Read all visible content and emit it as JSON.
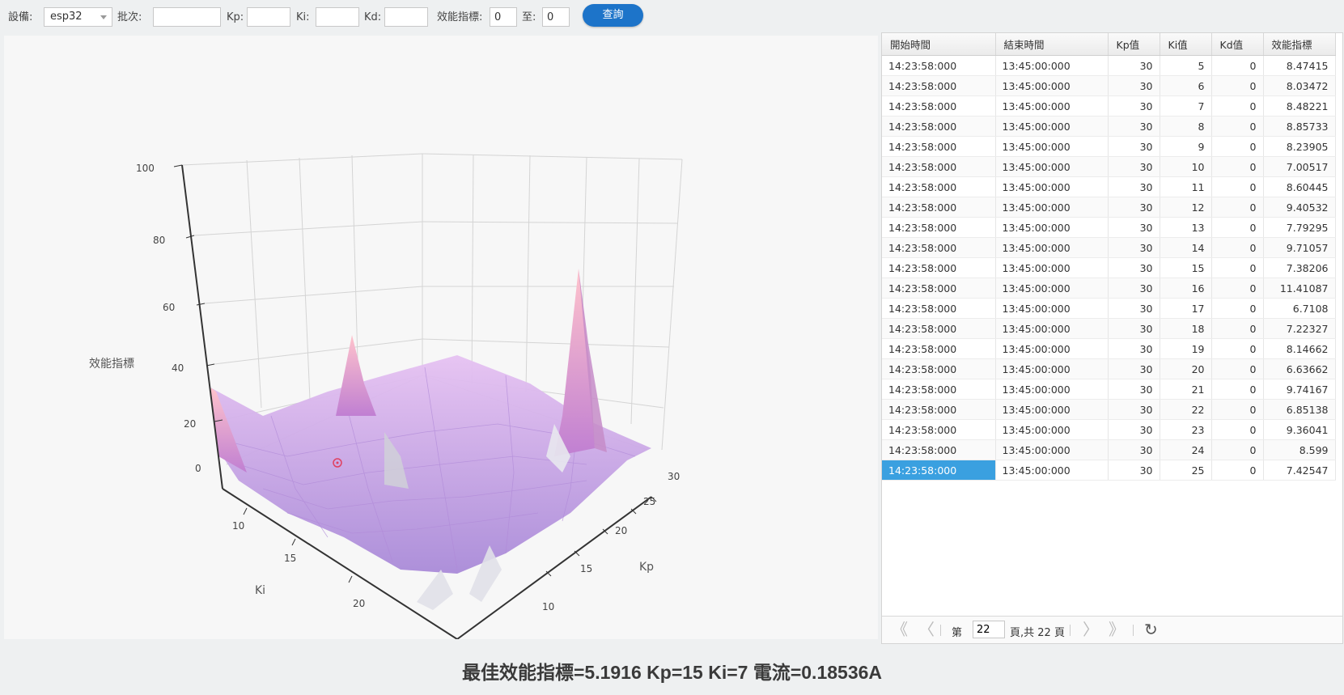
{
  "toolbar": {
    "device_label": "設備:",
    "device_value": "esp32",
    "batch_label": "批次:",
    "batch_value": "",
    "kp_label": "Kp:",
    "kp_value": "",
    "ki_label": "Ki:",
    "ki_value": "",
    "kd_label": "Kd:",
    "kd_value": "",
    "perf_label": "效能指標:",
    "perf_from": "0",
    "perf_to_label": "至:",
    "perf_to": "0",
    "query_button": "查詢"
  },
  "chart_data": {
    "type": "surface3d",
    "zlabel": "效能指標",
    "ylabel": "Ki",
    "xlabel": "Kp",
    "z_ticks": [
      "0",
      "20",
      "40",
      "60",
      "80",
      "100"
    ],
    "ki_ticks": [
      "10",
      "15",
      "20"
    ],
    "kp_ticks": [
      "10",
      "15",
      "20",
      "25",
      "30"
    ],
    "zlim": [
      0,
      100
    ],
    "ki_range": [
      5,
      25
    ],
    "kp_range": [
      5,
      30
    ],
    "peaks": [
      {
        "kp": 30,
        "ki": 27,
        "z": 80
      },
      {
        "kp": 6,
        "ki": 5,
        "z": 40
      },
      {
        "kp": 22,
        "ki": 5,
        "z": 25
      }
    ],
    "surface_color": "#c9a6f2",
    "best_point": {
      "kp": 15,
      "ki": 7,
      "z": 5.1916
    }
  },
  "grid": {
    "columns": [
      "開始時間",
      "結束時間",
      "Kp值",
      "Ki值",
      "Kd值",
      "效能指標"
    ],
    "rows": [
      [
        "14:23:58:000",
        "13:45:00:000",
        "30",
        "5",
        "0",
        "8.47415"
      ],
      [
        "14:23:58:000",
        "13:45:00:000",
        "30",
        "6",
        "0",
        "8.03472"
      ],
      [
        "14:23:58:000",
        "13:45:00:000",
        "30",
        "7",
        "0",
        "8.48221"
      ],
      [
        "14:23:58:000",
        "13:45:00:000",
        "30",
        "8",
        "0",
        "8.85733"
      ],
      [
        "14:23:58:000",
        "13:45:00:000",
        "30",
        "9",
        "0",
        "8.23905"
      ],
      [
        "14:23:58:000",
        "13:45:00:000",
        "30",
        "10",
        "0",
        "7.00517"
      ],
      [
        "14:23:58:000",
        "13:45:00:000",
        "30",
        "11",
        "0",
        "8.60445"
      ],
      [
        "14:23:58:000",
        "13:45:00:000",
        "30",
        "12",
        "0",
        "9.40532"
      ],
      [
        "14:23:58:000",
        "13:45:00:000",
        "30",
        "13",
        "0",
        "7.79295"
      ],
      [
        "14:23:58:000",
        "13:45:00:000",
        "30",
        "14",
        "0",
        "9.71057"
      ],
      [
        "14:23:58:000",
        "13:45:00:000",
        "30",
        "15",
        "0",
        "7.38206"
      ],
      [
        "14:23:58:000",
        "13:45:00:000",
        "30",
        "16",
        "0",
        "11.41087"
      ],
      [
        "14:23:58:000",
        "13:45:00:000",
        "30",
        "17",
        "0",
        "6.7108"
      ],
      [
        "14:23:58:000",
        "13:45:00:000",
        "30",
        "18",
        "0",
        "7.22327"
      ],
      [
        "14:23:58:000",
        "13:45:00:000",
        "30",
        "19",
        "0",
        "8.14662"
      ],
      [
        "14:23:58:000",
        "13:45:00:000",
        "30",
        "20",
        "0",
        "6.63662"
      ],
      [
        "14:23:58:000",
        "13:45:00:000",
        "30",
        "21",
        "0",
        "9.74167"
      ],
      [
        "14:23:58:000",
        "13:45:00:000",
        "30",
        "22",
        "0",
        "6.85138"
      ],
      [
        "14:23:58:000",
        "13:45:00:000",
        "30",
        "23",
        "0",
        "9.36041"
      ],
      [
        "14:23:58:000",
        "13:45:00:000",
        "30",
        "24",
        "0",
        "8.599"
      ],
      [
        "14:23:58:000",
        "13:45:00:000",
        "30",
        "25",
        "0",
        "7.42547"
      ]
    ],
    "selected_row": 20
  },
  "pager": {
    "first": "《",
    "prev": "〈",
    "page_prefix": "第",
    "current_page": "22",
    "page_suffix": "頁,共 22 頁",
    "next": "〉",
    "last": "》",
    "refresh": "↻"
  },
  "result_text": "最佳效能指標=5.1916 Kp=15 Ki=7 電流=0.18536A"
}
